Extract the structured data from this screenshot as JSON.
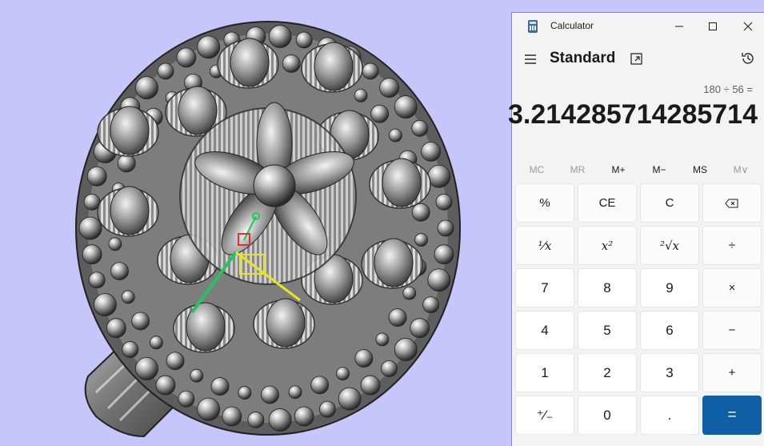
{
  "app": {
    "title": "Calculator",
    "mode": "Standard"
  },
  "display": {
    "expression": "180 ÷ 56 =",
    "result": "3.214285714285714"
  },
  "memory": {
    "mc": "MC",
    "mr": "MR",
    "mplus": "M+",
    "mminus": "M−",
    "ms": "MS",
    "mlist": "M∨"
  },
  "keys": {
    "percent": "%",
    "ce": "CE",
    "c": "C",
    "backspace": "⌫",
    "reciprocal": "¹⁄x",
    "square": "x²",
    "sqrt": "²√x",
    "divide": "÷",
    "seven": "7",
    "eight": "8",
    "nine": "9",
    "multiply": "×",
    "four": "4",
    "five": "5",
    "six": "6",
    "minus": "−",
    "one": "1",
    "two": "2",
    "three": "3",
    "plus": "+",
    "negate": "⁺⁄₋",
    "zero": "0",
    "decimal": ".",
    "equals": "="
  },
  "colors": {
    "viewport_bg": "#c6c6fb",
    "equals_bg": "#0f5fa6",
    "calc_bg": "#f3f3f3"
  }
}
